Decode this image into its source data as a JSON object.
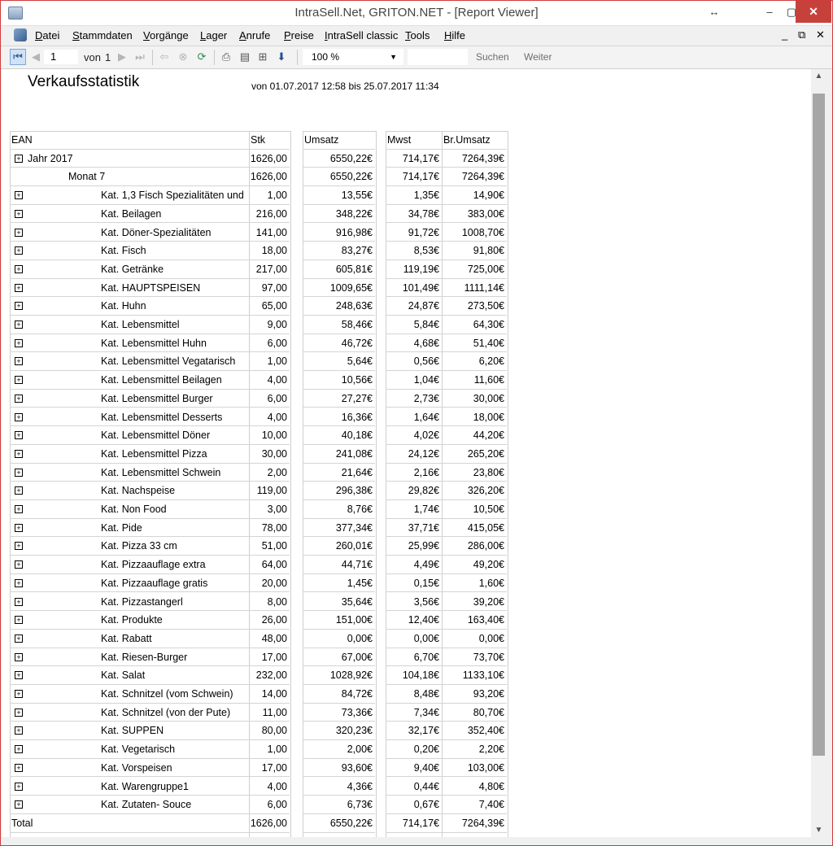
{
  "window": {
    "title": "IntraSell.Net, GRITON.NET - [Report Viewer]"
  },
  "menu": {
    "items": [
      "Datei",
      "Stammdaten",
      "Vorgänge",
      "Lager",
      "Anrufe",
      "Preise",
      "IntraSell classic",
      "Tools",
      "Hilfe"
    ]
  },
  "toolbar": {
    "page_current": "1",
    "of_label": "von",
    "page_total": "1",
    "zoom": "100 %",
    "search_value": "",
    "search_label": "Suchen",
    "next_label": "Weiter"
  },
  "report": {
    "title": "Verkaufsstatistik",
    "date_range": "von 01.07.2017 12:58 bis 25.07.2017 11:34",
    "columns": {
      "ean": "EAN",
      "stk": "Stk",
      "umsatz": "Umsatz",
      "mwst": "Mwst",
      "brumsatz": "Br.Umsatz"
    },
    "rows": [
      {
        "label": "Jahr 2017",
        "level": 0,
        "expand": true,
        "stk": "1626,00",
        "umsatz": "6550,22€",
        "mwst": "714,17€",
        "brumsatz": "7264,39€"
      },
      {
        "label": "Monat 7",
        "level": 1,
        "expand": false,
        "stk": "1626,00",
        "umsatz": "6550,22€",
        "mwst": "714,17€",
        "brumsatz": "7264,39€"
      },
      {
        "label": "Kat. 1,3 Fisch Spezialitäten und",
        "level": 2,
        "expand": true,
        "stk": "1,00",
        "umsatz": "13,55€",
        "mwst": "1,35€",
        "brumsatz": "14,90€"
      },
      {
        "label": "Kat. Beilagen",
        "level": 2,
        "expand": true,
        "stk": "216,00",
        "umsatz": "348,22€",
        "mwst": "34,78€",
        "brumsatz": "383,00€"
      },
      {
        "label": "Kat. Döner-Spezialitäten",
        "level": 2,
        "expand": true,
        "stk": "141,00",
        "umsatz": "916,98€",
        "mwst": "91,72€",
        "brumsatz": "1008,70€"
      },
      {
        "label": "Kat. Fisch",
        "level": 2,
        "expand": true,
        "stk": "18,00",
        "umsatz": "83,27€",
        "mwst": "8,53€",
        "brumsatz": "91,80€"
      },
      {
        "label": "Kat. Getränke",
        "level": 2,
        "expand": true,
        "stk": "217,00",
        "umsatz": "605,81€",
        "mwst": "119,19€",
        "brumsatz": "725,00€"
      },
      {
        "label": "Kat. HAUPTSPEISEN",
        "level": 2,
        "expand": true,
        "stk": "97,00",
        "umsatz": "1009,65€",
        "mwst": "101,49€",
        "brumsatz": "1111,14€"
      },
      {
        "label": "Kat. Huhn",
        "level": 2,
        "expand": true,
        "stk": "65,00",
        "umsatz": "248,63€",
        "mwst": "24,87€",
        "brumsatz": "273,50€"
      },
      {
        "label": "Kat. Lebensmittel",
        "level": 2,
        "expand": true,
        "stk": "9,00",
        "umsatz": "58,46€",
        "mwst": "5,84€",
        "brumsatz": "64,30€"
      },
      {
        "label": "Kat. Lebensmittel  Huhn",
        "level": 2,
        "expand": true,
        "stk": "6,00",
        "umsatz": "46,72€",
        "mwst": "4,68€",
        "brumsatz": "51,40€"
      },
      {
        "label": "Kat. Lebensmittel  Vegatarisch",
        "level": 2,
        "expand": true,
        "stk": "1,00",
        "umsatz": "5,64€",
        "mwst": "0,56€",
        "brumsatz": "6,20€"
      },
      {
        "label": "Kat. Lebensmittel Beilagen",
        "level": 2,
        "expand": true,
        "stk": "4,00",
        "umsatz": "10,56€",
        "mwst": "1,04€",
        "brumsatz": "11,60€"
      },
      {
        "label": "Kat. Lebensmittel Burger",
        "level": 2,
        "expand": true,
        "stk": "6,00",
        "umsatz": "27,27€",
        "mwst": "2,73€",
        "brumsatz": "30,00€"
      },
      {
        "label": "Kat. Lebensmittel Desserts",
        "level": 2,
        "expand": true,
        "stk": "4,00",
        "umsatz": "16,36€",
        "mwst": "1,64€",
        "brumsatz": "18,00€"
      },
      {
        "label": "Kat. Lebensmittel Döner",
        "level": 2,
        "expand": true,
        "stk": "10,00",
        "umsatz": "40,18€",
        "mwst": "4,02€",
        "brumsatz": "44,20€"
      },
      {
        "label": "Kat. Lebensmittel Pizza",
        "level": 2,
        "expand": true,
        "stk": "30,00",
        "umsatz": "241,08€",
        "mwst": "24,12€",
        "brumsatz": "265,20€"
      },
      {
        "label": "Kat. Lebensmittel Schwein",
        "level": 2,
        "expand": true,
        "stk": "2,00",
        "umsatz": "21,64€",
        "mwst": "2,16€",
        "brumsatz": "23,80€"
      },
      {
        "label": "Kat. Nachspeise",
        "level": 2,
        "expand": true,
        "stk": "119,00",
        "umsatz": "296,38€",
        "mwst": "29,82€",
        "brumsatz": "326,20€"
      },
      {
        "label": "Kat. Non Food",
        "level": 2,
        "expand": true,
        "stk": "3,00",
        "umsatz": "8,76€",
        "mwst": "1,74€",
        "brumsatz": "10,50€"
      },
      {
        "label": "Kat. Pide",
        "level": 2,
        "expand": true,
        "stk": "78,00",
        "umsatz": "377,34€",
        "mwst": "37,71€",
        "brumsatz": "415,05€"
      },
      {
        "label": "Kat. Pizza  33 cm",
        "level": 2,
        "expand": true,
        "stk": "51,00",
        "umsatz": "260,01€",
        "mwst": "25,99€",
        "brumsatz": "286,00€"
      },
      {
        "label": "Kat. Pizzaauflage extra",
        "level": 2,
        "expand": true,
        "stk": "64,00",
        "umsatz": "44,71€",
        "mwst": "4,49€",
        "brumsatz": "49,20€"
      },
      {
        "label": "Kat. Pizzaauflage gratis",
        "level": 2,
        "expand": true,
        "stk": "20,00",
        "umsatz": "1,45€",
        "mwst": "0,15€",
        "brumsatz": "1,60€"
      },
      {
        "label": "Kat. Pizzastangerl",
        "level": 2,
        "expand": true,
        "stk": "8,00",
        "umsatz": "35,64€",
        "mwst": "3,56€",
        "brumsatz": "39,20€"
      },
      {
        "label": "Kat. Produkte",
        "level": 2,
        "expand": true,
        "stk": "26,00",
        "umsatz": "151,00€",
        "mwst": "12,40€",
        "brumsatz": "163,40€"
      },
      {
        "label": "Kat. Rabatt",
        "level": 2,
        "expand": true,
        "stk": "48,00",
        "umsatz": "0,00€",
        "mwst": "0,00€",
        "brumsatz": "0,00€"
      },
      {
        "label": "Kat. Riesen-Burger",
        "level": 2,
        "expand": true,
        "stk": "17,00",
        "umsatz": "67,00€",
        "mwst": "6,70€",
        "brumsatz": "73,70€"
      },
      {
        "label": "Kat. Salat",
        "level": 2,
        "expand": true,
        "stk": "232,00",
        "umsatz": "1028,92€",
        "mwst": "104,18€",
        "brumsatz": "1133,10€"
      },
      {
        "label": "Kat. Schnitzel (vom Schwein)",
        "level": 2,
        "expand": true,
        "stk": "14,00",
        "umsatz": "84,72€",
        "mwst": "8,48€",
        "brumsatz": "93,20€"
      },
      {
        "label": "Kat. Schnitzel (von der Pute)",
        "level": 2,
        "expand": true,
        "stk": "11,00",
        "umsatz": "73,36€",
        "mwst": "7,34€",
        "brumsatz": "80,70€"
      },
      {
        "label": "Kat. SUPPEN",
        "level": 2,
        "expand": true,
        "stk": "80,00",
        "umsatz": "320,23€",
        "mwst": "32,17€",
        "brumsatz": "352,40€"
      },
      {
        "label": "Kat. Vegetarisch",
        "level": 2,
        "expand": true,
        "stk": "1,00",
        "umsatz": "2,00€",
        "mwst": "0,20€",
        "brumsatz": "2,20€"
      },
      {
        "label": "Kat. Vorspeisen",
        "level": 2,
        "expand": true,
        "stk": "17,00",
        "umsatz": "93,60€",
        "mwst": "9,40€",
        "brumsatz": "103,00€"
      },
      {
        "label": "Kat. Warengruppe1",
        "level": 2,
        "expand": true,
        "stk": "4,00",
        "umsatz": "4,36€",
        "mwst": "0,44€",
        "brumsatz": "4,80€"
      },
      {
        "label": "Kat. Zutaten- Souce",
        "level": 2,
        "expand": true,
        "stk": "6,00",
        "umsatz": "6,73€",
        "mwst": "0,67€",
        "brumsatz": "7,40€"
      }
    ],
    "total": {
      "label": "Total",
      "stk": "1626,00",
      "umsatz": "6550,22€",
      "mwst": "714,17€",
      "brumsatz": "7264,39€"
    }
  },
  "icons": {
    "expand": "plus-box-icon",
    "window_resize": "resize-arrows-icon",
    "minimize": "minimize-icon",
    "maximize": "maximize-icon",
    "close": "close-icon"
  },
  "colors": {
    "close_button": "#c7413c",
    "scroll_thumb": "#a6a6a6",
    "window_border": "#d03b3b"
  }
}
